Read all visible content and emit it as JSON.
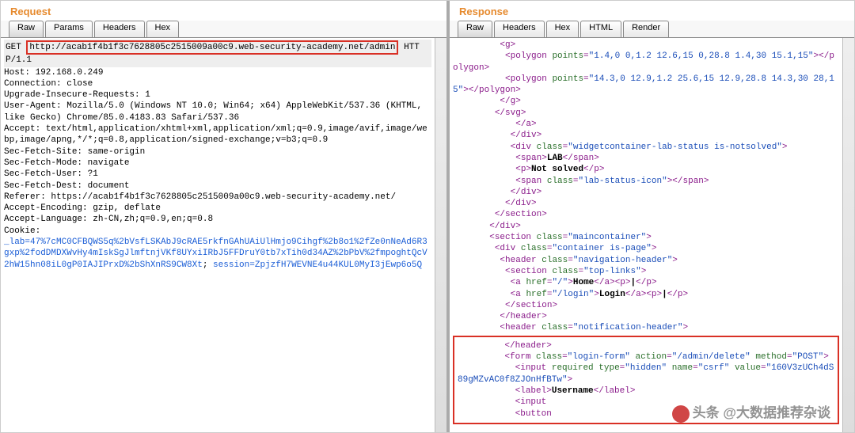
{
  "request": {
    "title": "Request",
    "tabs": [
      "Raw",
      "Params",
      "Headers",
      "Hex"
    ],
    "activeTab": 0,
    "method": "GET",
    "url": "http://acab1f4b1f3c7628805c2515009a00c9.web-security-academy.net/admin",
    "httpver": "HTTP/1.1",
    "headers": [
      "Host: 192.168.0.249",
      "Connection: close",
      "Upgrade-Insecure-Requests: 1",
      "User-Agent: Mozilla/5.0 (Windows NT 10.0; Win64; x64) AppleWebKit/537.36 (KHTML, like Gecko) Chrome/85.0.4183.83 Safari/537.36",
      "Accept: text/html,application/xhtml+xml,application/xml;q=0.9,image/avif,image/webp,image/apng,*/*;q=0.8,application/signed-exchange;v=b3;q=0.9",
      "Sec-Fetch-Site: same-origin",
      "Sec-Fetch-Mode: navigate",
      "Sec-Fetch-User: ?1",
      "Sec-Fetch-Dest: document",
      "Referer: https://acab1f4b1f3c7628805c2515009a00c9.web-security-academy.net/",
      "Accept-Encoding: gzip, deflate",
      "Accept-Language: zh-CN,zh;q=0.9,en;q=0.8"
    ],
    "cookieLabel": "Cookie:",
    "cookie_lab": "_lab=47%7cMC0CFBQWS5q%2bVsfLSKAbJ9cRAE5rkfnGAhUAiUlHmjo9Cihgf%2b8o1%2fZe0nNeAd6R3gxp%2fodDMDXWvHy4mIskSgJlmftnjVKf8UYxiIRbJ5FFDruY0tb7xTih0d34AZ%2bPbV%2fmpoghtQcV2hW15hn08iL0gP0IAJIPrxD%2bShXnRS9CW8Xt",
    "cookie_sep": "; ",
    "cookie_session": "session=ZpjzfH7WEVNE4u44KUL0MyI3jEwp6o5Q"
  },
  "response": {
    "title": "Response",
    "tabs": [
      "Raw",
      "Headers",
      "Hex",
      "HTML",
      "Render"
    ],
    "activeTab": 0,
    "lines": [
      {
        "i": 18,
        "h": "<g>"
      },
      {
        "i": 20,
        "h": "<polygon points=\"1.4,0 0,1.2 12.6,15 0,28.8 1.4,30 15.1,15\"></polygon>"
      },
      {
        "i": 20,
        "h": "<polygon points=\"14.3,0 12.9,1.2 25.6,15 12.9,28.8 14.3,30 28,15\"></polygon>"
      },
      {
        "i": 18,
        "h": "</g>"
      },
      {
        "i": 16,
        "h": "</svg>"
      },
      {
        "i": 24,
        "h": "</a>"
      },
      {
        "i": 22,
        "h": "</div>"
      },
      {
        "i": 22,
        "h": "<div class=\"widgetcontainer-lab-status is-notsolved\">"
      },
      {
        "i": 24,
        "h": "<span>[[LAB]]</span>"
      },
      {
        "i": 24,
        "h": "<p>[[Not solved]]</p>"
      },
      {
        "i": 24,
        "h": "<span class=\"lab-status-icon\"></span>"
      },
      {
        "i": 22,
        "h": "</div>"
      },
      {
        "i": 20,
        "h": "</div>"
      },
      {
        "i": 16,
        "h": "</section>"
      },
      {
        "i": 14,
        "h": "</div>"
      },
      {
        "i": 14,
        "h": "<section class=\"maincontainer\">"
      },
      {
        "i": 16,
        "h": "<div class=\"container is-page\">"
      },
      {
        "i": 18,
        "h": "<header class=\"navigation-header\">"
      },
      {
        "i": 20,
        "h": "<section class=\"top-links\">"
      },
      {
        "i": 22,
        "h": "<a href=\"/\">[[Home]]</a><p>[[|]]</p>"
      },
      {
        "i": 22,
        "h": "<a href=\"/login\">[[Login]]</a><p>[[|]]</p>"
      },
      {
        "i": 20,
        "h": "</section>"
      },
      {
        "i": 18,
        "h": "</header>"
      },
      {
        "i": 18,
        "h": "<header class=\"notification-header\">"
      }
    ],
    "highlighted": [
      {
        "i": 18,
        "h": "</header>"
      },
      {
        "i": 18,
        "h": "<form class=\"login-form\" action=\"/admin/delete\" method=\"POST\">"
      },
      {
        "i": 22,
        "h": "<input required type=\"hidden\" name=\"csrf\" value=\"160V3zUCh4dS89gMZvAC0f8ZJOnHfBTw\">"
      },
      {
        "i": 22,
        "h": "<label>[[Username]]</label>"
      },
      {
        "i": 22,
        "h": "<input "
      },
      {
        "i": 22,
        "h": "<button"
      }
    ]
  },
  "watermark": "头条 @大数据推荐杂谈"
}
